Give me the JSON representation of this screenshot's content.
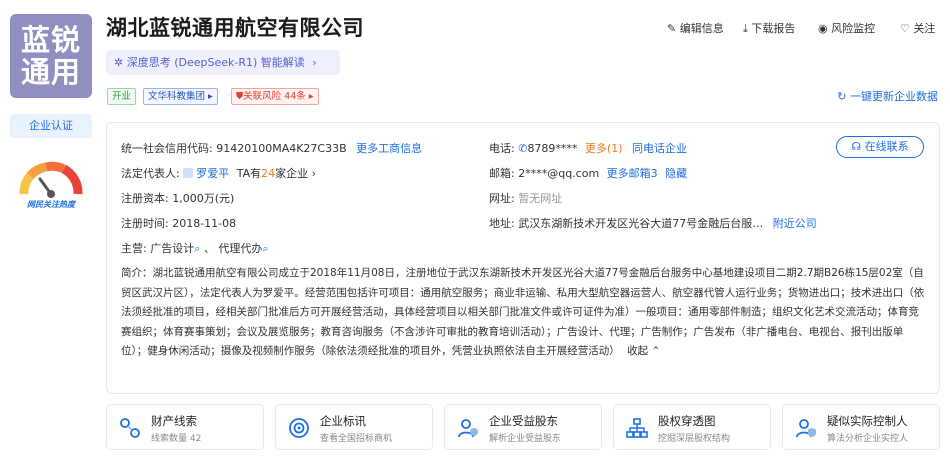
{
  "logo": {
    "line1": "蓝锐",
    "line2": "通用"
  },
  "certify_label": "企业认证",
  "heat_label": "网民关注热度",
  "company_name": "湖北蓝锐通用航空有限公司",
  "ai_button": "深度思考 (DeepSeek-R1) 智能解读",
  "tags": {
    "status": "开业",
    "group": "文华科教集团",
    "risk": "关联风险 44条"
  },
  "actions": {
    "edit": "编辑信息",
    "download": "下载报告",
    "monitor": "风险监控",
    "follow": "关注"
  },
  "refresh": "一键更新企业数据",
  "info": {
    "credit_label": "统一社会信用代码:",
    "credit_value": "91420100MA4K27C33B",
    "credit_more": "更多工商信息",
    "legal_label": "法定代表人:",
    "legal_name": "罗爱平",
    "legal_ta_a": "TA有",
    "legal_ta_n": "24",
    "legal_ta_b": "家企业",
    "capital_label": "注册资本:",
    "capital_value": "1,000万(元)",
    "date_label": "注册时间:",
    "date_value": "2018-11-08",
    "phone_label": "电话:",
    "phone_value": "8789****",
    "phone_more": "更多(1)",
    "phone_same": "同电话企业",
    "email_label": "邮箱:",
    "email_value": "2****@qq.com",
    "email_more": "更多邮箱3",
    "email_hide": "隐藏",
    "web_label": "网址:",
    "web_value": "暂无网址",
    "addr_label": "地址:",
    "addr_value": "武汉东湖新技术开发区光谷大道77号金融后台服…",
    "addr_near": "附近公司",
    "main_label": "主营:",
    "main_1": "广告设计",
    "main_2": "代理代办",
    "online": "在线联系"
  },
  "intro": "简介：湖北蓝锐通用航空有限公司成立于2018年11月08日，注册地位于武汉东湖新技术开发区光谷大道77号金融后台服务中心基地建设项目二期2.7期B26栋15层02室（自贸区武汉片区），法定代表人为罗爱平。经营范围包括许可项目：通用航空服务；商业非运输、私用大型航空器运营人、航空器代管人运行业务；货物进出口；技术进出口（依法须经批准的项目，经相关部门批准后方可开展经营活动，具体经营项目以相关部门批准文件或许可证件为准）一般项目：通用零部件制造；组织文化艺术交流活动；体育竞赛组织；体育赛事策划；会议及展览服务；教育咨询服务（不含涉许可审批的教育培训活动）；广告设计、代理；广告制作；广告发布（非广播电台、电视台、报刊出版单位）；健身休闲活动；摄像及视频制作服务（除依法须经批准的项目外，凭营业执照依法自主开展经营活动）",
  "intro_collapse": "收起",
  "features": [
    {
      "title": "财产线索",
      "sub": "线索数量 42",
      "icon": "clue-icon"
    },
    {
      "title": "企业标讯",
      "sub": "查看全国招标商机",
      "icon": "target-icon"
    },
    {
      "title": "企业受益股东",
      "sub": "解析企业受益股东",
      "icon": "shareholder-icon"
    },
    {
      "title": "股权穿透图",
      "sub": "挖掘深层股权结构",
      "icon": "equity-tree-icon"
    },
    {
      "title": "疑似实际控制人",
      "sub": "算法分析企业实控人",
      "icon": "controller-icon"
    }
  ]
}
